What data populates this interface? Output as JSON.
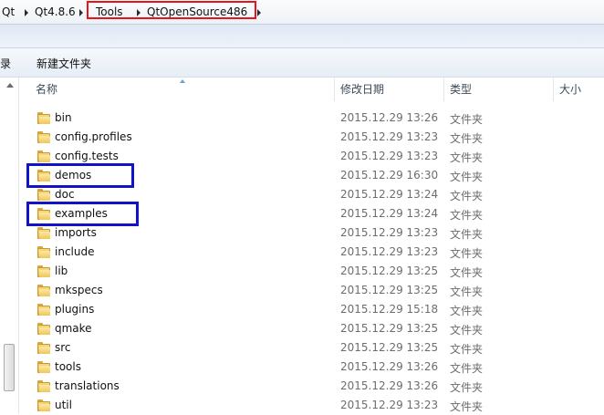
{
  "breadcrumb": {
    "items": [
      {
        "label": "Qt"
      },
      {
        "label": "Qt4.8.6"
      },
      {
        "label": "Tools"
      },
      {
        "label": "QtOpenSource486"
      }
    ]
  },
  "toolbar": {
    "partial_label": "录",
    "new_folder_label": "新建文件夹"
  },
  "columns": {
    "name": "名称",
    "modified": "修改日期",
    "type": "类型",
    "size": "大小"
  },
  "files": [
    {
      "name": "bin",
      "modified": "2015.12.29 13:26",
      "type": "文件夹"
    },
    {
      "name": "config.profiles",
      "modified": "2015.12.29 13:23",
      "type": "文件夹"
    },
    {
      "name": "config.tests",
      "modified": "2015.12.29 13:23",
      "type": "文件夹"
    },
    {
      "name": "demos",
      "modified": "2015.12.29 16:30",
      "type": "文件夹"
    },
    {
      "name": "doc",
      "modified": "2015.12.29 13:24",
      "type": "文件夹"
    },
    {
      "name": "examples",
      "modified": "2015.12.29 13:24",
      "type": "文件夹"
    },
    {
      "name": "imports",
      "modified": "2015.12.29 13:23",
      "type": "文件夹"
    },
    {
      "name": "include",
      "modified": "2015.12.29 13:23",
      "type": "文件夹"
    },
    {
      "name": "lib",
      "modified": "2015.12.29 13:25",
      "type": "文件夹"
    },
    {
      "name": "mkspecs",
      "modified": "2015.12.29 13:25",
      "type": "文件夹"
    },
    {
      "name": "plugins",
      "modified": "2015.12.29 15:18",
      "type": "文件夹"
    },
    {
      "name": "qmake",
      "modified": "2015.12.29 13:25",
      "type": "文件夹"
    },
    {
      "name": "src",
      "modified": "2015.12.29 13:25",
      "type": "文件夹"
    },
    {
      "name": "tools",
      "modified": "2015.12.29 13:26",
      "type": "文件夹"
    },
    {
      "name": "translations",
      "modified": "2015.12.29 13:26",
      "type": "文件夹"
    },
    {
      "name": "util",
      "modified": "2015.12.29 13:23",
      "type": "文件夹"
    }
  ],
  "annotation_colors": {
    "breadcrumb_highlight": "#e8141b",
    "folder_highlight": "#1212c8"
  }
}
